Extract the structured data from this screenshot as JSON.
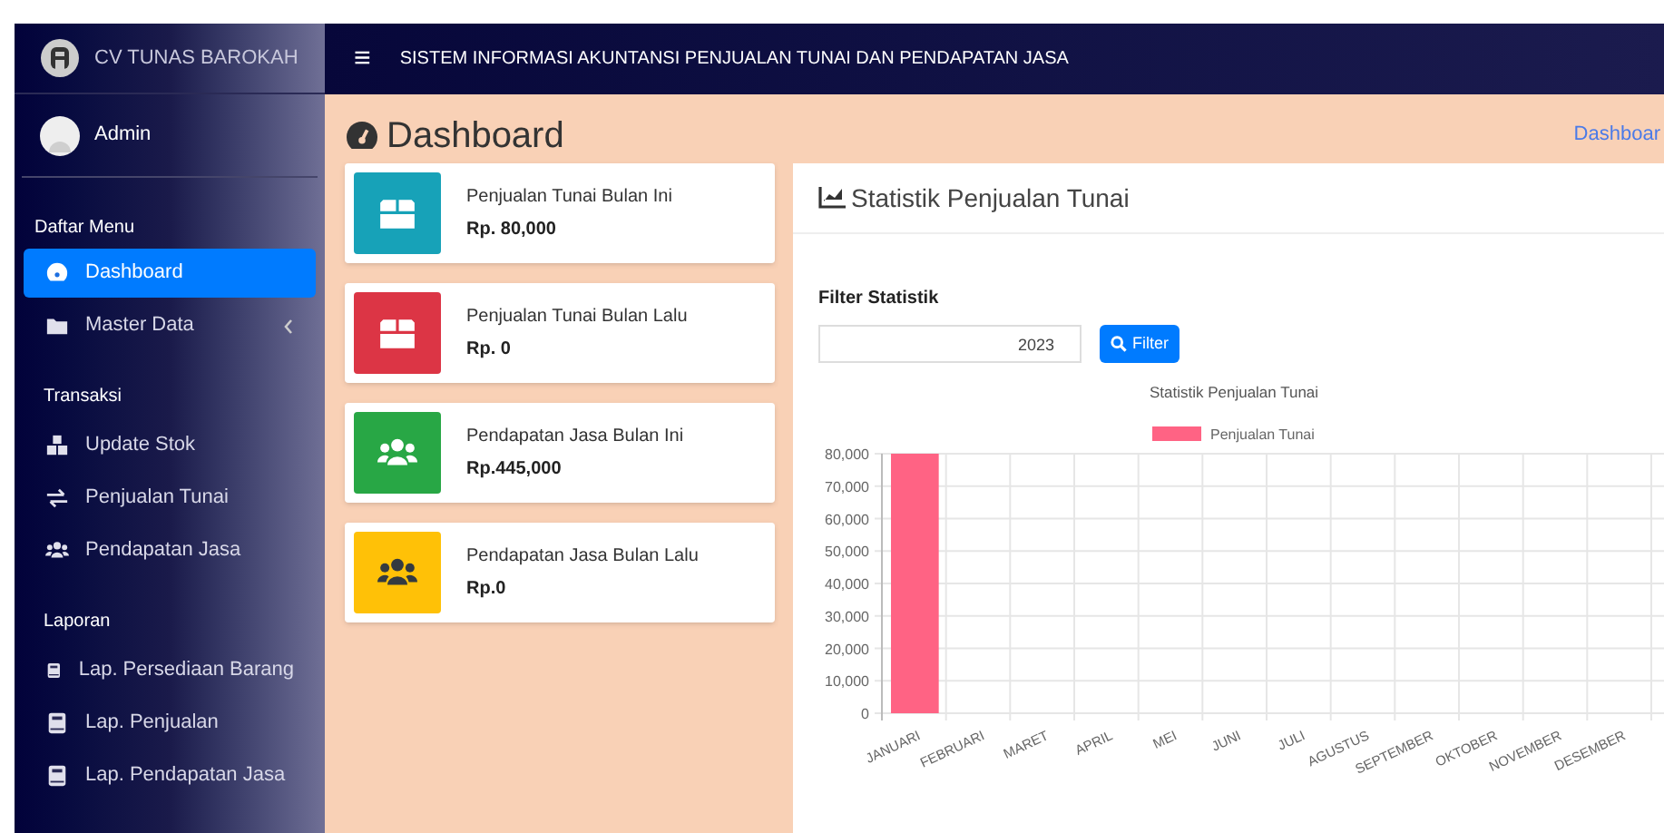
{
  "brand": {
    "name": "CV TUNAS BAROKAH"
  },
  "header": {
    "menu_glyph": "≡",
    "title": "SISTEM INFORMASI AKUNTANSI PENJUALAN TUNAI DAN PENDAPATAN JASA"
  },
  "user": {
    "name": "Admin"
  },
  "sidebar": {
    "sections": [
      {
        "heading": "Daftar Menu",
        "items": [
          {
            "label": "Dashboard",
            "kind": "dashboard",
            "selected": true
          },
          {
            "label": "Master Data",
            "kind": "folder",
            "selected": false,
            "expanded": false
          }
        ]
      },
      {
        "heading": "Transaksi",
        "items": [
          {
            "label": "Update Stok",
            "kind": "stock",
            "selected": false
          },
          {
            "label": "Penjualan Tunai",
            "kind": "exchange",
            "selected": false
          },
          {
            "label": "Pendapatan Jasa",
            "kind": "users",
            "selected": false
          }
        ]
      },
      {
        "heading": "Laporan",
        "items": [
          {
            "label": "Lap. Persediaan Barang",
            "kind": "report",
            "selected": false
          },
          {
            "label": "Lap. Penjualan",
            "kind": "report",
            "selected": false
          },
          {
            "label": "Lap. Pendapatan Jasa",
            "kind": "report",
            "selected": false
          }
        ]
      }
    ]
  },
  "page": {
    "title": "Dashboard",
    "breadcrumb": "Dashboar"
  },
  "stat_cards": [
    {
      "label": "Penjualan Tunai Bulan Ini",
      "value": "Rp. 80,000",
      "kind": "box",
      "color": "#17a2b8"
    },
    {
      "label": "Penjualan Tunai Bulan Lalu",
      "value": "Rp. 0",
      "kind": "box",
      "color": "#dc3545"
    },
    {
      "label": "Pendapatan Jasa Bulan Ini",
      "value": "Rp.445,000",
      "kind": "users",
      "color": "#28a745"
    },
    {
      "label": "Pendapatan Jasa Bulan Lalu",
      "value": "Rp.0",
      "kind": "users",
      "color": "#ffc107"
    }
  ],
  "chart_card": {
    "title": "Statistik Penjualan Tunai",
    "filter": {
      "label": "Filter Statistik",
      "year": "2023",
      "button": "Filter"
    },
    "chart_data": {
      "type": "bar",
      "title": "Statistik Penjualan Tunai",
      "categories": [
        "JANUARI",
        "FEBRUARI",
        "MARET",
        "APRIL",
        "MEI",
        "JUNI",
        "JULI",
        "AGUSTUS",
        "SEPTEMBER",
        "OKTOBER",
        "NOVEMBER",
        "DESEMBER"
      ],
      "series": [
        {
          "name": "Penjualan Tunai",
          "color": "#ff6384",
          "values": [
            80000,
            0,
            0,
            0,
            0,
            0,
            0,
            0,
            0,
            0,
            0,
            0
          ]
        }
      ],
      "ylim": [
        0,
        80000
      ],
      "grid": true,
      "yticks": [
        {
          "value": 0,
          "label": "0"
        },
        {
          "value": 10000,
          "label": "10,000"
        },
        {
          "value": 20000,
          "label": "20,000"
        },
        {
          "value": 30000,
          "label": "30,000"
        },
        {
          "value": 40000,
          "label": "40,000"
        },
        {
          "value": 50000,
          "label": "50,000"
        },
        {
          "value": 60000,
          "label": "60,000"
        },
        {
          "value": 70000,
          "label": "70,000"
        },
        {
          "value": 80000,
          "label": "80,000"
        }
      ]
    }
  }
}
